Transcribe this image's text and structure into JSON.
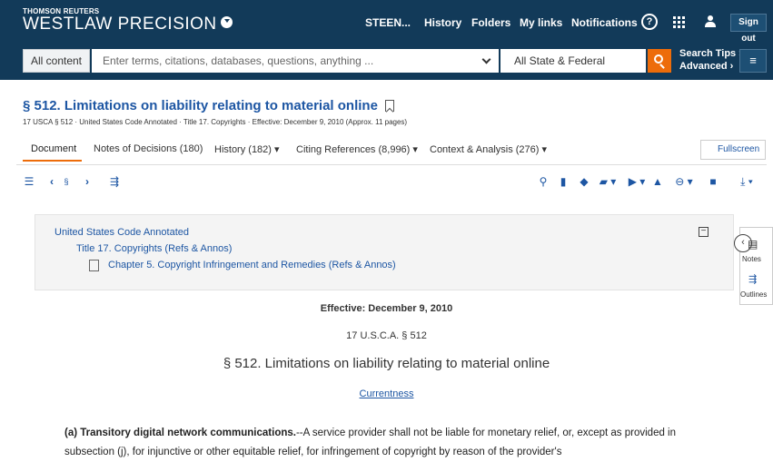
{
  "header": {
    "brand_small": "THOMSON REUTERS",
    "brand_big": "WESTLAW PRECISION",
    "nav": {
      "user": "STEEN...",
      "history": "History",
      "folders": "Folders",
      "mylinks": "My links",
      "notifications": "Notifications"
    },
    "help": "?",
    "signout": "Sign out"
  },
  "search": {
    "scope": "All content",
    "placeholder": "Enter terms, citations, databases, questions, anything ...",
    "jurisdiction": "All State & Federal",
    "tips": "Search Tips",
    "advanced": "Advanced"
  },
  "document": {
    "title": "§ 512. Limitations on liability relating to material online",
    "meta": {
      "cite": "17 USCA § 512",
      "source": "United States Code Annotated",
      "title": "Title 17. Copyrights",
      "effective": "Effective: December 9, 2010",
      "pages": "(Approx. 11 pages)"
    },
    "tabs": {
      "document": "Document",
      "notes": "Notes of Decisions (180)",
      "history": "History (182)",
      "citing": "Citing References (8,996)",
      "context": "Context & Analysis (276)"
    },
    "fullscreen": "Fullscreen"
  },
  "toc": {
    "level1": "United States Code Annotated",
    "level2": "Title 17. Copyrights (Refs & Annos)",
    "level3": "Chapter 5. Copyright Infringement and Remedies (Refs & Annos)"
  },
  "side": {
    "notes": "Notes",
    "outlines": "Outlines"
  },
  "body": {
    "effective": "Effective: December 9, 2010",
    "cite": "17 U.S.C.A. § 512",
    "heading": "§ 512. Limitations on liability relating to material online",
    "currentness": "Currentness",
    "para_lead": "(a) Transitory digital network communications.",
    "para_text": "--A service provider shall not be liable for monetary relief, or, except as provided in subsection (j), for injunctive or other equitable relief, for infringement of copyright by reason of the provider's"
  },
  "colors": {
    "header_bg": "#123a59",
    "accent": "#ed6c0a",
    "link": "#1d56a3"
  }
}
